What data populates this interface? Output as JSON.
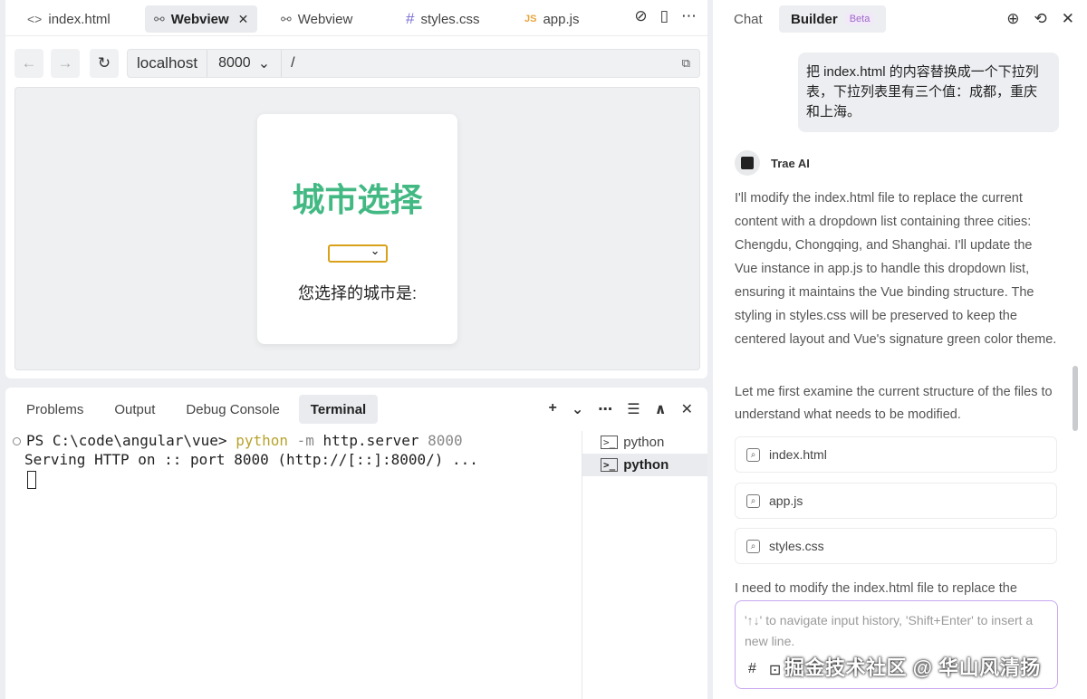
{
  "editor": {
    "tabs": [
      {
        "label": "index.html",
        "icon": "<>"
      },
      {
        "label": "Webview",
        "icon": "⚯"
      },
      {
        "label": "Webview",
        "icon": "⚯"
      },
      {
        "label": "styles.css",
        "icon": "#"
      },
      {
        "label": "app.js",
        "icon": "JS"
      }
    ],
    "close_glyph": "✕",
    "tools": [
      "⊘",
      "▯",
      "⋯"
    ]
  },
  "browser": {
    "back": "←",
    "forward": "→",
    "reload": "↻",
    "host": "localhost",
    "port": "8000",
    "port_caret": "⌄",
    "path": "/",
    "copy": "⧉"
  },
  "page": {
    "title": "城市选择",
    "select_caret": "⌄",
    "result_label": "您选择的城市是:"
  },
  "terminal": {
    "tabs": [
      "Problems",
      "Output",
      "Debug Console",
      "Terminal"
    ],
    "tools": [
      "+",
      "⌄",
      "⋯",
      "☰",
      "∧",
      "✕"
    ],
    "line1_prompt": "PS C:\\code\\angular\\vue> ",
    "line1_cmd": "python",
    "line1_flag": " -m ",
    "line1_arg1": "http.server",
    "line1_arg2": " 8000",
    "line2": "Serving HTTP on :: port 8000 (http://[::]:8000/) ...",
    "sessions": [
      {
        "label": "python"
      },
      {
        "label": "python"
      }
    ],
    "session_icon": ">_"
  },
  "chat": {
    "tab_chat": "Chat",
    "tab_builder": "Builder",
    "beta": "Beta",
    "tools": [
      "⊕",
      "⟲",
      "✕"
    ],
    "user_message": "把 index.html 的内容替换成一个下拉列表，下拉列表里有三个值：成都，重庆和上海。",
    "ai_name": "Trae AI",
    "ai_paragraph1": "I'll modify the index.html file to replace the current content with a dropdown list containing three cities: Chengdu, Chongqing, and Shanghai. I'll update the Vue instance in app.js to handle this dropdown list, ensuring it maintains the Vue binding structure. The styling in styles.css will be preserved to keep the centered layout and Vue's signature green color theme.",
    "ai_paragraph2": "Let me first examine the current structure of the files to understand what needs to be modified.",
    "files": [
      "index.html",
      "app.js",
      "styles.css"
    ],
    "file_icon": "⌕",
    "ai_paragraph3": "I need to modify the index.html file to replace the",
    "input_placeholder": "'↑↓' to navigate input history, 'Shift+Enter' to insert a new line.",
    "input_tools": [
      "#",
      "⊡"
    ]
  },
  "watermark": "掘金技术社区 @ 华山风清扬"
}
